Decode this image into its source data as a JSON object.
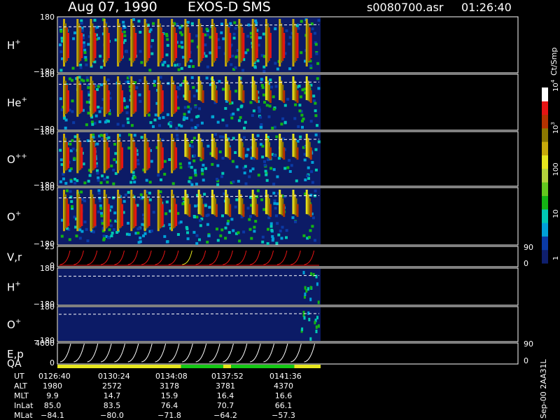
{
  "header": {
    "date": "Aug 07, 1990",
    "instrument": "EXOS-D SMS",
    "file": "s0080700.asr",
    "time": "01:26:40"
  },
  "footer_code": "Sep-00 2AA31L",
  "colorbar": {
    "label": "Ct/Smp",
    "ticks": [
      {
        "label": "1",
        "value": 1
      },
      {
        "label": "10",
        "value": 10
      },
      {
        "label": "100",
        "value": 100
      },
      {
        "label": "10",
        "sup": "3",
        "value": 1000
      },
      {
        "label": "10",
        "sup": "4",
        "value": 10000
      }
    ],
    "colors": [
      "#0f1f6e",
      "#0a3aa6",
      "#00a0d8",
      "#00c8b4",
      "#14b414",
      "#64c81e",
      "#b4d23c",
      "#e6e61e",
      "#c8aa0a",
      "#8c7800",
      "#b43200",
      "#e61414",
      "#ffffff"
    ]
  },
  "chart_data": {
    "type": "heatmap",
    "x_time_range": [
      "01:26:40",
      "01:41:36+"
    ],
    "panels": [
      {
        "label": "H",
        "sup": "+",
        "y_ticks": [
          "180",
          "−180"
        ],
        "ylim": [
          -180,
          180
        ],
        "kind": "spectrogram"
      },
      {
        "label": "He",
        "sup": "+",
        "y_ticks": [
          "180",
          "−180"
        ],
        "ylim": [
          -180,
          180
        ],
        "kind": "spectrogram"
      },
      {
        "label": "O",
        "sup": "++",
        "y_ticks": [
          "180",
          "−180"
        ],
        "ylim": [
          -180,
          180
        ],
        "kind": "spectrogram"
      },
      {
        "label": "O",
        "sup": "+",
        "y_ticks": [
          "180",
          "−180"
        ],
        "ylim": [
          -180,
          180
        ],
        "kind": "spectrogram"
      },
      {
        "label": "V,r",
        "sup": "",
        "y_ticks": [
          "25",
          "0"
        ],
        "right_ticks": [
          "90",
          "0"
        ],
        "ylim": [
          0,
          25
        ],
        "kind": "line"
      },
      {
        "label": "H",
        "sup": "+",
        "y_ticks": [
          "180",
          "−180"
        ],
        "ylim": [
          -180,
          180
        ],
        "kind": "mass"
      },
      {
        "label": "O",
        "sup": "+",
        "y_ticks": [
          "180",
          "−180"
        ],
        "ylim": [
          -180,
          180
        ],
        "kind": "mass"
      },
      {
        "label": "E,p",
        "label2": "QA",
        "sup": "",
        "y_ticks": [
          "4000",
          "0"
        ],
        "right_ticks": [
          "90",
          "0"
        ],
        "ylim": [
          0,
          4000
        ],
        "kind": "energy"
      }
    ],
    "orbit_table": {
      "rows": [
        {
          "name": "UT",
          "values": [
            "0126:40",
            "0130:24",
            "0134:08",
            "0137:52",
            "0141:36"
          ]
        },
        {
          "name": "ALT",
          "values": [
            "1980",
            "2572",
            "3178",
            "3781",
            "4370"
          ]
        },
        {
          "name": "MLT",
          "values": [
            "9.9",
            "14.7",
            "15.9",
            "16.4",
            "16.6"
          ]
        },
        {
          "name": "InLat",
          "values": [
            "85.0",
            "83.5",
            "76.4",
            "70.7",
            "66.1"
          ]
        },
        {
          "name": "MLat",
          "values": [
            "−84.1",
            "−80.0",
            "−71.8",
            "−64.2",
            "−57.3"
          ]
        }
      ]
    },
    "qa_segments": [
      {
        "color": "#e6e61e",
        "from": 0.0,
        "to": 0.47
      },
      {
        "color": "#14c814",
        "from": 0.47,
        "to": 0.63
      },
      {
        "color": "#e6e61e",
        "from": 0.63,
        "to": 0.66
      },
      {
        "color": "#14c814",
        "from": 0.66,
        "to": 0.9
      },
      {
        "color": "#e6e61e",
        "from": 0.9,
        "to": 1.0
      }
    ]
  }
}
